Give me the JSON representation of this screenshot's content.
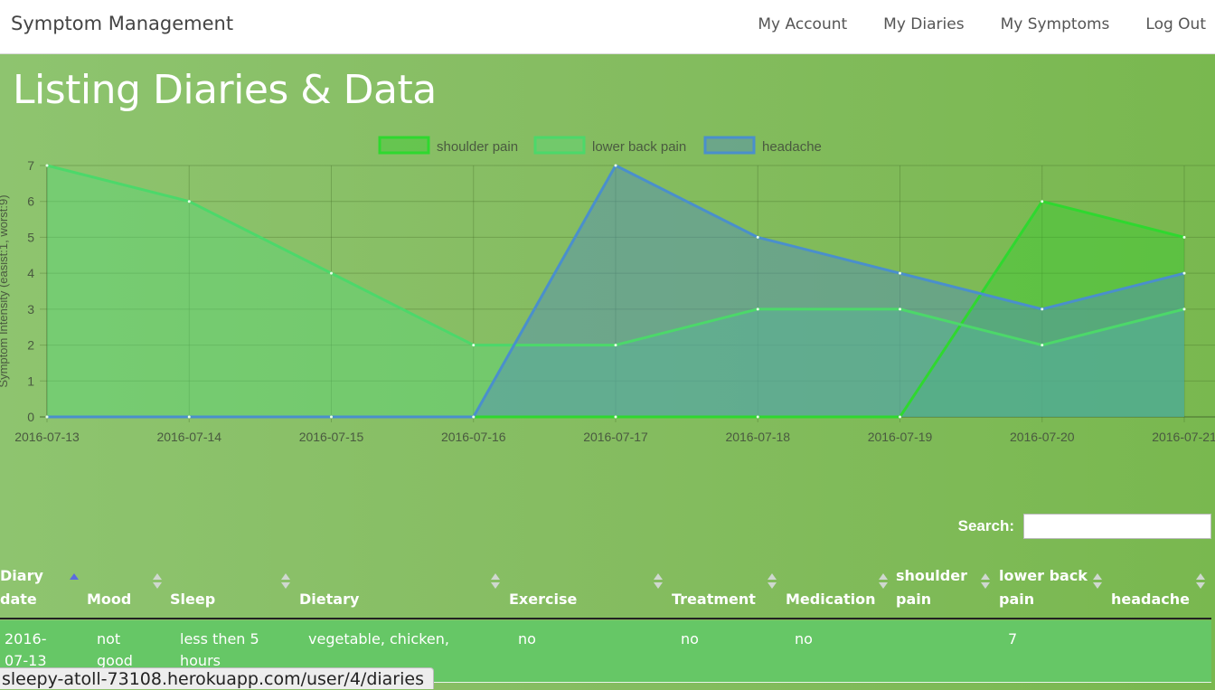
{
  "navbar": {
    "brand": "Symptom Management",
    "links": [
      "My Account",
      "My Diaries",
      "My Symptoms",
      "Log Out"
    ]
  },
  "page_title": "Listing Diaries & Data",
  "chart_data": {
    "type": "area",
    "x": [
      "2016-07-13",
      "2016-07-14",
      "2016-07-15",
      "2016-07-16",
      "2016-07-17",
      "2016-07-18",
      "2016-07-19",
      "2016-07-20",
      "2016-07-21"
    ],
    "xlabel": "",
    "ylabel": "Symptom Intensity (easist:1, worst:9)",
    "ylim": [
      0,
      7
    ],
    "yticks": [
      0,
      1,
      2,
      3,
      4,
      5,
      6,
      7
    ],
    "grid": true,
    "legend": "top-center",
    "series": [
      {
        "name": "shoulder pain",
        "values": [
          0,
          0,
          0,
          0,
          0,
          0,
          0,
          6,
          5
        ],
        "color": "#2fd82f"
      },
      {
        "name": "lower back pain",
        "values": [
          7,
          6,
          4,
          2,
          2,
          3,
          3,
          2,
          3
        ],
        "color": "#4cd86a"
      },
      {
        "name": "headache",
        "values": [
          0,
          0,
          0,
          0,
          7,
          5,
          4,
          3,
          4
        ],
        "color": "#4a8fcc"
      }
    ]
  },
  "search": {
    "label": "Search:",
    "value": ""
  },
  "table": {
    "columns": [
      "Diary\ndate",
      "Mood",
      "Sleep",
      "Dietary",
      "Exercise",
      "Treatment",
      "Medication",
      "shoulder\npain",
      "lower back\npain",
      "headache"
    ],
    "rows": [
      [
        "2016-\n07-13",
        "not\ngood",
        "less then 5\nhours",
        "vegetable, chicken,",
        "no",
        "no",
        "no",
        "",
        "7",
        ""
      ]
    ]
  },
  "status_bar": {
    "url": "sleepy-atoll-73108.herokuapp.com/user/4/diaries"
  }
}
